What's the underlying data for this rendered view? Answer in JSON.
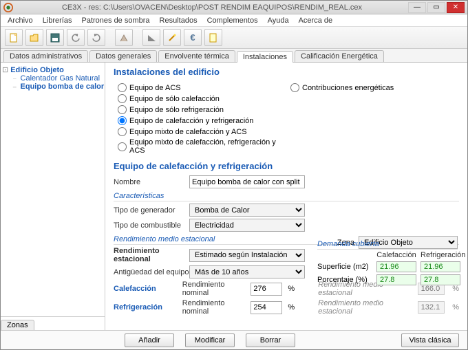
{
  "title": "CE3X - res: C:\\Users\\OVACEN\\Desktop\\POST RENDIM EAQUIPOS\\RENDIM_REAL.cex",
  "menu": [
    "Archivo",
    "Librerías",
    "Patrones de sombra",
    "Resultados",
    "Complementos",
    "Ayuda",
    "Acerca de"
  ],
  "tabs": [
    "Datos administrativos",
    "Datos generales",
    "Envolvente térmica",
    "Instalaciones",
    "Calificación Energética"
  ],
  "tabs_active": 3,
  "tree": {
    "root": "Edificio Objeto",
    "items": [
      "Calentador Gas Natural",
      "Equipo bomba de calor con spli"
    ]
  },
  "sidebar_tab": "Zonas",
  "section1": "Instalaciones del edificio",
  "radios": {
    "left": [
      "Equipo de ACS",
      "Equipo de sólo calefacción",
      "Equipo de sólo refrigeración",
      "Equipo de calefacción y refrigeración",
      "Equipo mixto de calefacción y ACS",
      "Equipo mixto de calefacción, refrigeración y ACS"
    ],
    "right": "Contribuciones energéticas",
    "selected": 3
  },
  "section2": "Equipo de calefacción y refrigeración",
  "nombre": {
    "label": "Nombre",
    "value": "Equipo bomba de calor con split"
  },
  "zona": {
    "label": "Zona",
    "value": "Edificio Objeto"
  },
  "caracteristicas": {
    "title": "Características",
    "gen_label": "Tipo de generador",
    "gen_value": "Bomba de Calor",
    "comb_label": "Tipo de combustible",
    "comb_value": "Electricidad"
  },
  "demanda": {
    "title": "Demanda cubierta",
    "col1": "Calefacción",
    "col2": "Refrigeración",
    "row1": "Superficie (m2)",
    "v11": "21.96",
    "v12": "21.96",
    "row2": "Porcentaje (%)",
    "v21": "27.8",
    "v22": "27.8"
  },
  "rendimiento": {
    "title": "Rendimiento medio estacional",
    "est_label": "Rendimiento estacional",
    "est_value": "Estimado según Instalación",
    "ant_label": "Antigüedad del equipo",
    "ant_value": "Más de 10 años",
    "cal_label": "Calefacción",
    "ref_label": "Refrigeración",
    "rn_label": "Rendimiento nominal",
    "cal_rn": "276",
    "ref_rn": "254",
    "pct": "%",
    "rme_label": "Rendimiento medio estacional",
    "cal_rme": "166.0",
    "ref_rme": "132.1"
  },
  "footer": {
    "add": "Añadir",
    "mod": "Modificar",
    "del": "Borrar",
    "classic": "Vista clásica"
  }
}
